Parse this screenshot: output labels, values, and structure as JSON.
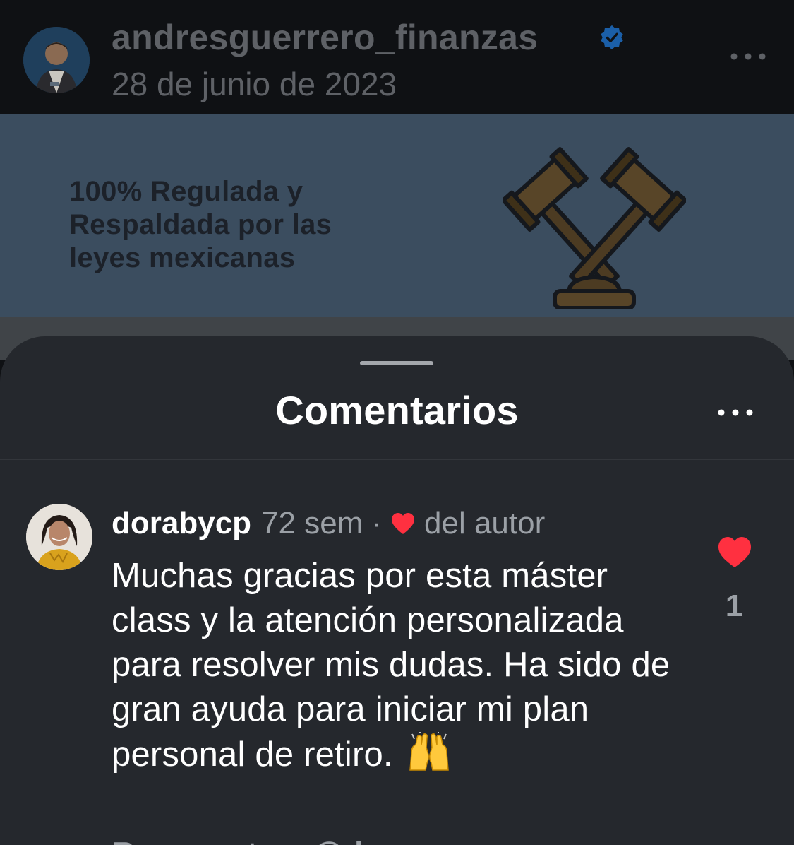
{
  "post": {
    "username": "andresguerrero_finanzas",
    "date": "28 de junio de 2023",
    "image_text": "100% Regulada y\nRespaldada por las\nleyes mexicanas",
    "verified_icon": "verified-badge-icon",
    "more_icon": "more-horizontal-icon",
    "image_icon": "gavel-icon"
  },
  "comments_sheet": {
    "title": "Comentarios",
    "more_icon": "more-horizontal-icon"
  },
  "comment": {
    "username": "dorabycp",
    "time": "72 sem",
    "separator": "·",
    "author_like_text": "del autor",
    "text": "Muchas gracias por esta máster class y la atención personalizada para resolver mis dudas.  Ha sido de gran ayuda para iniciar mi plan personal de retiro.",
    "emoji": "raising-hands-icon",
    "like_count": "1"
  },
  "next_comment": {
    "text": "Respuesta a @dora"
  },
  "colors": {
    "like_red": "#ff3040",
    "sheet_bg": "#25282d",
    "verified_blue": "#1b5fa8"
  }
}
